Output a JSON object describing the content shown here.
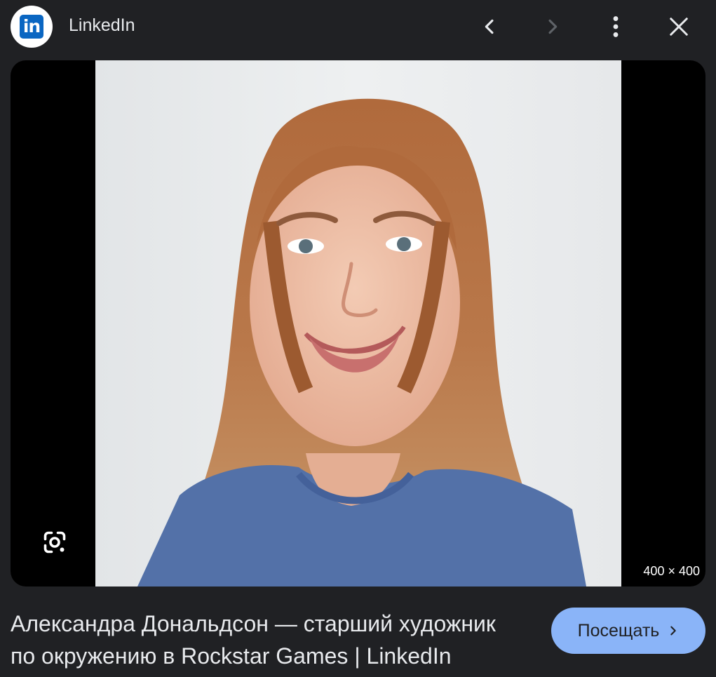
{
  "header": {
    "source_name": "LinkedIn",
    "logo_icon": "linkedin-logo",
    "logo_text": "in",
    "buttons": [
      "chevron-left-icon",
      "chevron-right-icon",
      "more-vert-icon",
      "close-icon"
    ]
  },
  "viewer": {
    "dimensions": "400 × 400",
    "lens_icon": "google-lens-icon"
  },
  "result": {
    "title_line1": "Александра Дональдсон — старший художник",
    "title_line2": "по окружению в Rockstar Games | LinkedIn",
    "visit_label": "Посещать"
  },
  "colors": {
    "background": "#202124",
    "accent": "#8ab4f8",
    "linkedin_blue": "#0a66c2"
  }
}
